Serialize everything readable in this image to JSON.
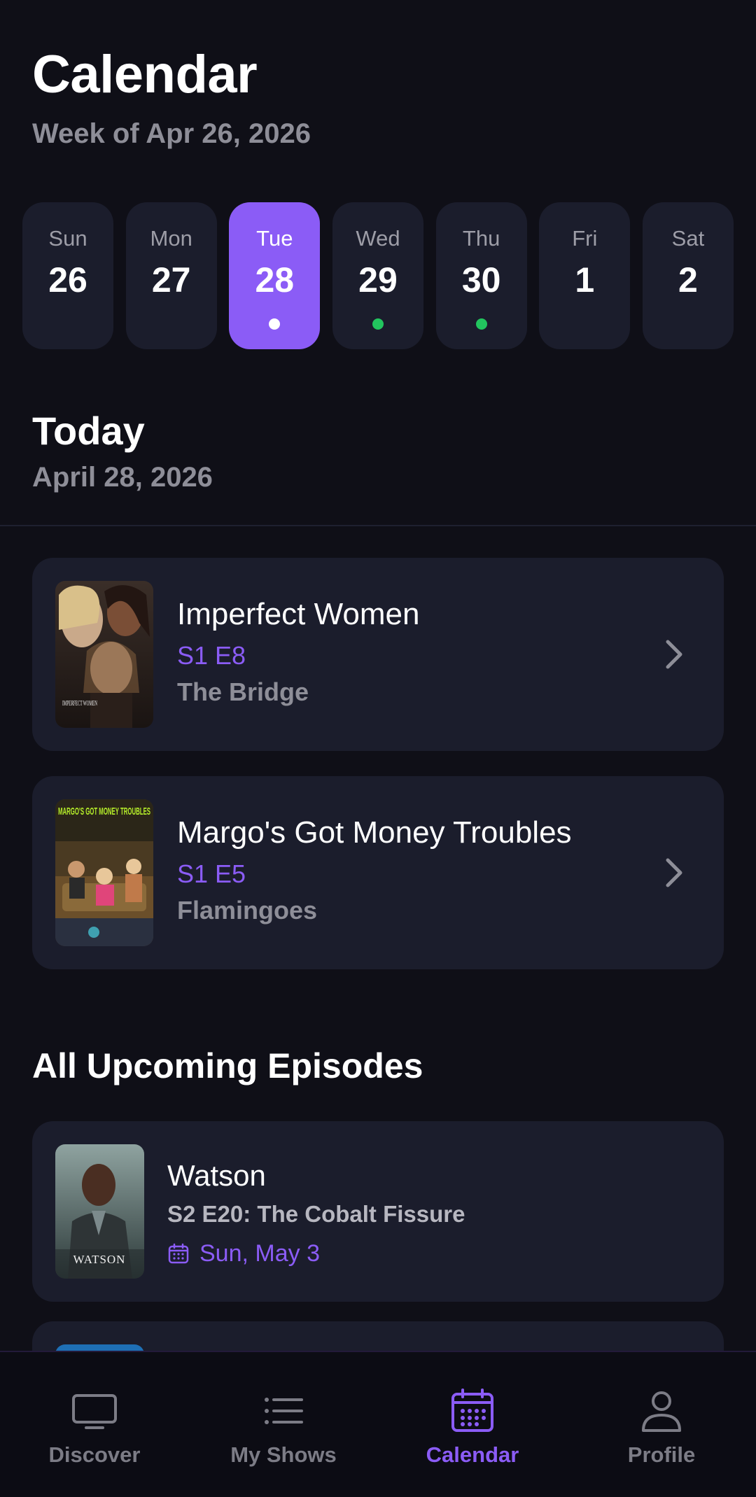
{
  "header": {
    "title": "Calendar",
    "subtitle": "Week of Apr 26, 2026"
  },
  "week": [
    {
      "day": "Sun",
      "date": "26",
      "selected": false,
      "dot": null
    },
    {
      "day": "Mon",
      "date": "27",
      "selected": false,
      "dot": null
    },
    {
      "day": "Tue",
      "date": "28",
      "selected": true,
      "dot": "#ffffff"
    },
    {
      "day": "Wed",
      "date": "29",
      "selected": false,
      "dot": "#22c55e"
    },
    {
      "day": "Thu",
      "date": "30",
      "selected": false,
      "dot": "#22c55e"
    },
    {
      "day": "Fri",
      "date": "1",
      "selected": false,
      "dot": null
    },
    {
      "day": "Sat",
      "date": "2",
      "selected": false,
      "dot": null
    }
  ],
  "today": {
    "title": "Today",
    "date": "April 28, 2026",
    "episodes": [
      {
        "show": "Imperfect Women",
        "code": "S1 E8",
        "title": "The Bridge",
        "poster_text": "IMPERFECT WOMEN"
      },
      {
        "show": "Margo's Got Money Troubles",
        "code": "S1 E5",
        "title": "Flamingoes",
        "poster_text": "MARGO'S GOT MONEY TROUBLES"
      }
    ]
  },
  "upcoming": {
    "title": "All Upcoming Episodes",
    "items": [
      {
        "show": "Watson",
        "episode": "S2 E20: The Cobalt Fissure",
        "date": "Sun, May 3",
        "poster_text": "WATSON"
      }
    ]
  },
  "nav": {
    "items": [
      {
        "label": "Discover",
        "icon": "tv-icon",
        "active": false
      },
      {
        "label": "My Shows",
        "icon": "list-icon",
        "active": false
      },
      {
        "label": "Calendar",
        "icon": "calendar-icon",
        "active": true
      },
      {
        "label": "Profile",
        "icon": "user-icon",
        "active": false
      }
    ]
  },
  "colors": {
    "accent": "#8b5cf6",
    "background": "#0f0f17",
    "card": "#1b1d2c",
    "dot_green": "#22c55e"
  }
}
